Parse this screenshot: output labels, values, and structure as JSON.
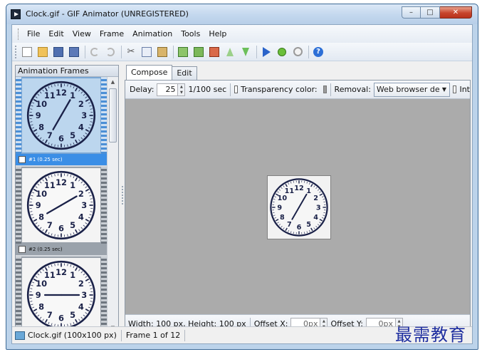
{
  "window": {
    "title": "Clock.gif - GIF Animator (UNREGISTERED)"
  },
  "window_controls": {
    "minimize": "–",
    "maximize": "□",
    "close": "✕"
  },
  "menu": [
    "File",
    "Edit",
    "View",
    "Frame",
    "Animation",
    "Tools",
    "Help"
  ],
  "toolbar_icons": [
    "new-icon",
    "open-icon",
    "save-icon",
    "save-as-icon",
    "undo-icon",
    "redo-icon",
    "cut-icon",
    "copy-icon",
    "paste-icon",
    "frame-icon",
    "add-frame-icon",
    "delete-frame-icon",
    "move-up-icon",
    "move-down-icon",
    "play-icon",
    "preview-icon",
    "timer-icon",
    "help-icon"
  ],
  "frames_panel": {
    "title": "Animation Frames",
    "frames": [
      {
        "caption": "#1 (0.25 sec)",
        "selected": true,
        "hour_hand_minutes": 5,
        "minute_hand_minutes": 5
      },
      {
        "caption": "#2 (0.25 sec)",
        "selected": false,
        "hour_hand_minutes": 10,
        "minute_hand_minutes": 10
      },
      {
        "caption": "",
        "selected": false,
        "hour_hand_minutes": 15,
        "minute_hand_minutes": 15
      }
    ]
  },
  "tabs": [
    "Compose",
    "Edit"
  ],
  "compose": {
    "delay_label": "Delay:",
    "delay_value": "25",
    "delay_unit": "1/100 sec",
    "transparency_label": "Transparency color:",
    "transparency_color": "#9a9a9a",
    "removal_label": "Removal:",
    "removal_value": "Web browser de",
    "interlace_label": "Int",
    "size_text": "Width: 100 px, Height: 100 px",
    "offset_x_label": "Offset X:",
    "offset_x_value": "0px",
    "offset_y_label": "Offset Y:",
    "offset_y_value": "0px",
    "canvas_clock": {
      "hour_hand_minutes": 5,
      "minute_hand_minutes": 5
    }
  },
  "clock_numerals": [
    "12",
    "1",
    "2",
    "3",
    "4",
    "5",
    "6",
    "7",
    "8",
    "9",
    "10",
    "11"
  ],
  "status": {
    "file": "Clock.gif (100x100 px)",
    "frame": "Frame 1 of 12"
  },
  "watermark": "最需教育",
  "colors": {
    "accent": "#3a8ee6",
    "clock_ink": "#1a2148",
    "canvas_bg": "#ababab"
  }
}
